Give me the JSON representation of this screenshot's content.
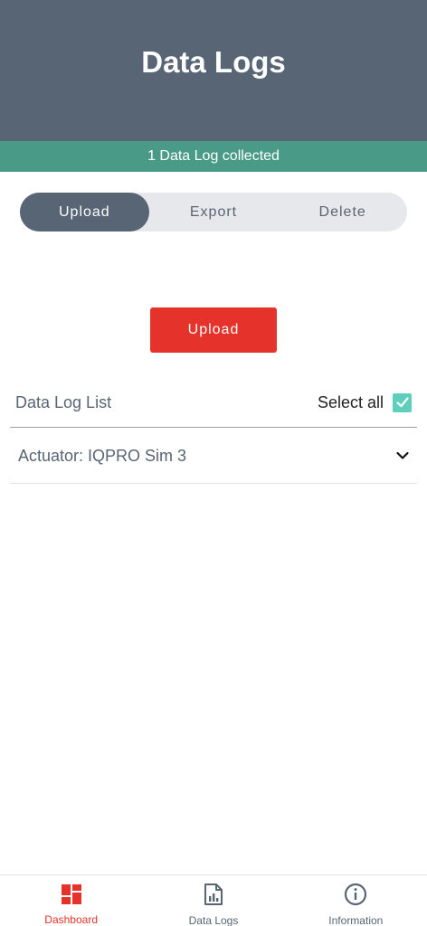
{
  "header": {
    "title": "Data Logs"
  },
  "status": {
    "text": "1 Data Log collected"
  },
  "segments": [
    {
      "label": "Upload",
      "active": true
    },
    {
      "label": "Export",
      "active": false
    },
    {
      "label": "Delete",
      "active": false
    }
  ],
  "action": {
    "upload_label": "Upload"
  },
  "list": {
    "title": "Data Log List",
    "select_all_label": "Select all",
    "select_all_checked": true,
    "items": [
      {
        "label": "Actuator: IQPRO Sim 3"
      }
    ]
  },
  "nav": {
    "items": [
      {
        "label": "Dashboard",
        "icon": "dashboard-icon",
        "active": true
      },
      {
        "label": "Data Logs",
        "icon": "data-logs-icon",
        "active": false
      },
      {
        "label": "Information",
        "icon": "information-icon",
        "active": false
      }
    ]
  },
  "colors": {
    "header_bg": "#586574",
    "status_bg": "#4a9a88",
    "accent_red": "#e5322b",
    "checkbox": "#5fcfbb"
  }
}
